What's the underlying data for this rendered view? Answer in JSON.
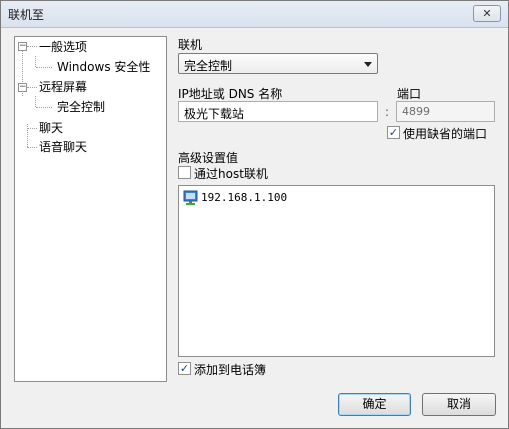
{
  "window": {
    "title": "联机至",
    "close_glyph": "✕"
  },
  "tree": {
    "items": [
      {
        "label": "一般选项",
        "expander": "−"
      },
      {
        "label": "Windows 安全性"
      },
      {
        "label": "远程屏幕",
        "expander": "−"
      },
      {
        "label": "完全控制"
      },
      {
        "label": "聊天"
      },
      {
        "label": "语音聊天"
      }
    ]
  },
  "connection": {
    "label": "联机",
    "selected": "完全控制"
  },
  "host": {
    "label": "IP地址或 DNS 名称",
    "value": "极光下载站"
  },
  "port": {
    "label": "端口",
    "separator": ":",
    "value": "4899",
    "default_checkbox_label": "使用缺省的端口",
    "default_checked": true
  },
  "advanced": {
    "label": "高级设置值",
    "via_host_label": "通过host联机",
    "via_host_checked": false,
    "entries": [
      {
        "icon": "computer-icon",
        "text": "192.168.1.100"
      }
    ]
  },
  "phonebook": {
    "label": "添加到电话簿",
    "checked": true
  },
  "buttons": {
    "ok": "确定",
    "cancel": "取消"
  },
  "colors": {
    "tree_line": "#a0a0a0",
    "default_button_border": "#3c7fb1",
    "checkmark": "#1d3d8f"
  }
}
